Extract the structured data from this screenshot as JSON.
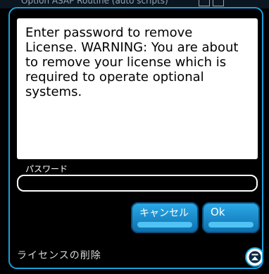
{
  "window": {
    "background_title": "Option ASAP Routine (auto scripts)"
  },
  "dialog": {
    "message": "Enter password to remove License. WARNING: You are about to remove your license which is required to operate optional systems.",
    "password_label": "パスワード",
    "password_value": "",
    "cancel_label": "キャンセル",
    "ok_label": "Ok",
    "footer_title": "ライセンスの削除",
    "collapse_icon": "eject-icon"
  },
  "colors": {
    "accent": "#1b9fd9",
    "button_top": "#2aa9e8",
    "button_bottom": "#0f6fae",
    "background": "#000000",
    "panel": "#ffffff"
  }
}
